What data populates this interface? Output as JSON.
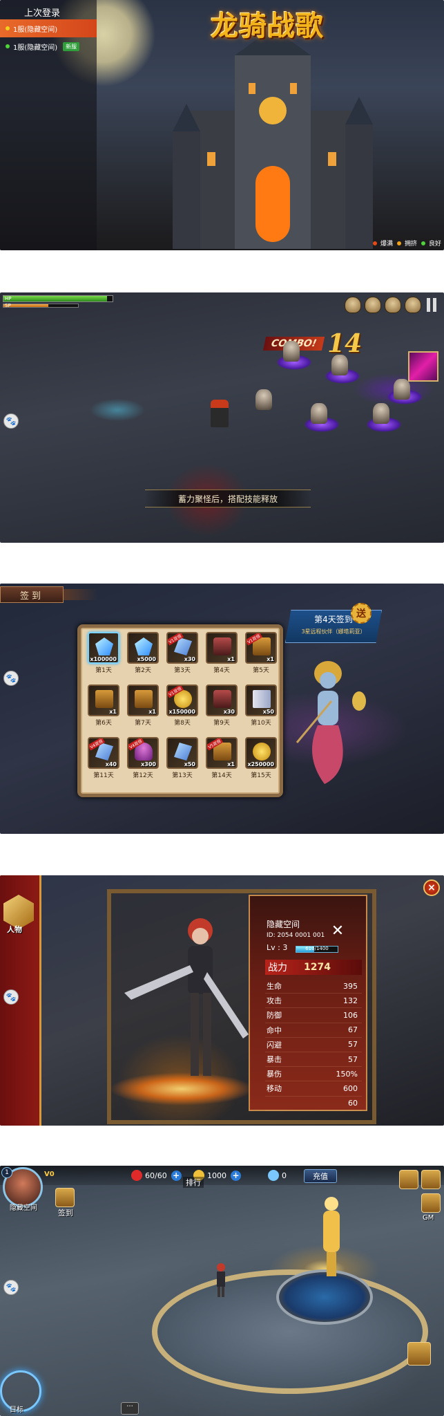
{
  "screen1": {
    "last_login_header": "上次登录",
    "servers": [
      {
        "label": "1服(隐藏空间)",
        "selected": true,
        "status_color": "#f0d21a",
        "badge": ""
      },
      {
        "label": "1服(隐藏空间)",
        "selected": false,
        "status_color": "#4fd23a",
        "badge": "新服"
      }
    ],
    "logo_text": "龙骑战歌",
    "legend": [
      {
        "label": "爆满",
        "color": "#e24a1a"
      },
      {
        "label": "拥挤",
        "color": "#f0a21a"
      },
      {
        "label": "良好",
        "color": "#4fd23a"
      }
    ]
  },
  "screen2": {
    "hp_label": "HP",
    "sp_label": "SP",
    "hp_fraction": 0.95,
    "sp_fraction": 0.6,
    "combo_label": "COMBO!",
    "combo_count": "14",
    "tip": "蓄力聚怪后，搭配技能释放"
  },
  "screen3": {
    "tab_label": "签到",
    "banner_title": "第4天签到",
    "banner_subtitle": "3星远程伙伴（娜塔莉亚）",
    "seal_char": "送",
    "rewards": [
      {
        "day": "第1天",
        "count": "x100000",
        "item": "gem",
        "tag": "",
        "selected": true
      },
      {
        "day": "第2天",
        "count": "x5000",
        "item": "gem",
        "tag": "",
        "selected": false
      },
      {
        "day": "第3天",
        "count": "x30",
        "item": "crystal",
        "tag": "V1双倍",
        "selected": false
      },
      {
        "day": "第4天",
        "count": "x1",
        "item": "pet",
        "tag": "",
        "selected": false
      },
      {
        "day": "第5天",
        "count": "x1",
        "item": "chest",
        "tag": "V1双倍",
        "selected": false
      },
      {
        "day": "第6天",
        "count": "x1",
        "item": "chest",
        "tag": "",
        "selected": false
      },
      {
        "day": "第7天",
        "count": "x1",
        "item": "chest",
        "tag": "",
        "selected": false
      },
      {
        "day": "第8天",
        "count": "x150000",
        "item": "gold",
        "tag": "V1双倍",
        "selected": false
      },
      {
        "day": "第9天",
        "count": "x30",
        "item": "pet",
        "tag": "",
        "selected": false
      },
      {
        "day": "第10天",
        "count": "x50",
        "item": "scroll",
        "tag": "",
        "selected": false
      },
      {
        "day": "第11天",
        "count": "x40",
        "item": "crystal",
        "tag": "V4双倍",
        "selected": false
      },
      {
        "day": "第12天",
        "count": "x300",
        "item": "mushroom",
        "tag": "V4双倍",
        "selected": false
      },
      {
        "day": "第13天",
        "count": "x50",
        "item": "crystal",
        "tag": "",
        "selected": false
      },
      {
        "day": "第14天",
        "count": "x1",
        "item": "chest",
        "tag": "V5双倍",
        "selected": false
      },
      {
        "day": "第15天",
        "count": "x250000",
        "item": "gold",
        "tag": "",
        "selected": false
      }
    ]
  },
  "screen4": {
    "side_label": "人物",
    "name": "隐藏空间",
    "id": "ID: 2054 0001 001",
    "level": "Lv : 3",
    "xp_text": "610/1400",
    "xp_fraction": 0.44,
    "power_label": "战力",
    "power_value": "1274",
    "stats": [
      {
        "k": "生命",
        "v": "395"
      },
      {
        "k": "攻击",
        "v": "132"
      },
      {
        "k": "防御",
        "v": "106"
      },
      {
        "k": "命中",
        "v": "67"
      },
      {
        "k": "闪避",
        "v": "57"
      },
      {
        "k": "暴击",
        "v": "57"
      },
      {
        "k": "暴伤",
        "v": "150%"
      },
      {
        "k": "移动",
        "v": "600"
      },
      {
        "k": "",
        "v": "60"
      }
    ],
    "close_icon": "×"
  },
  "screen5": {
    "level": "1",
    "vip": "V0",
    "player_name": "隐藏空间",
    "stamina": "60/60",
    "gold": "1000",
    "diamonds": "0",
    "recharge": "充值",
    "rank": "排行",
    "checkin": "签到",
    "gm": "GM",
    "target": "目标"
  }
}
